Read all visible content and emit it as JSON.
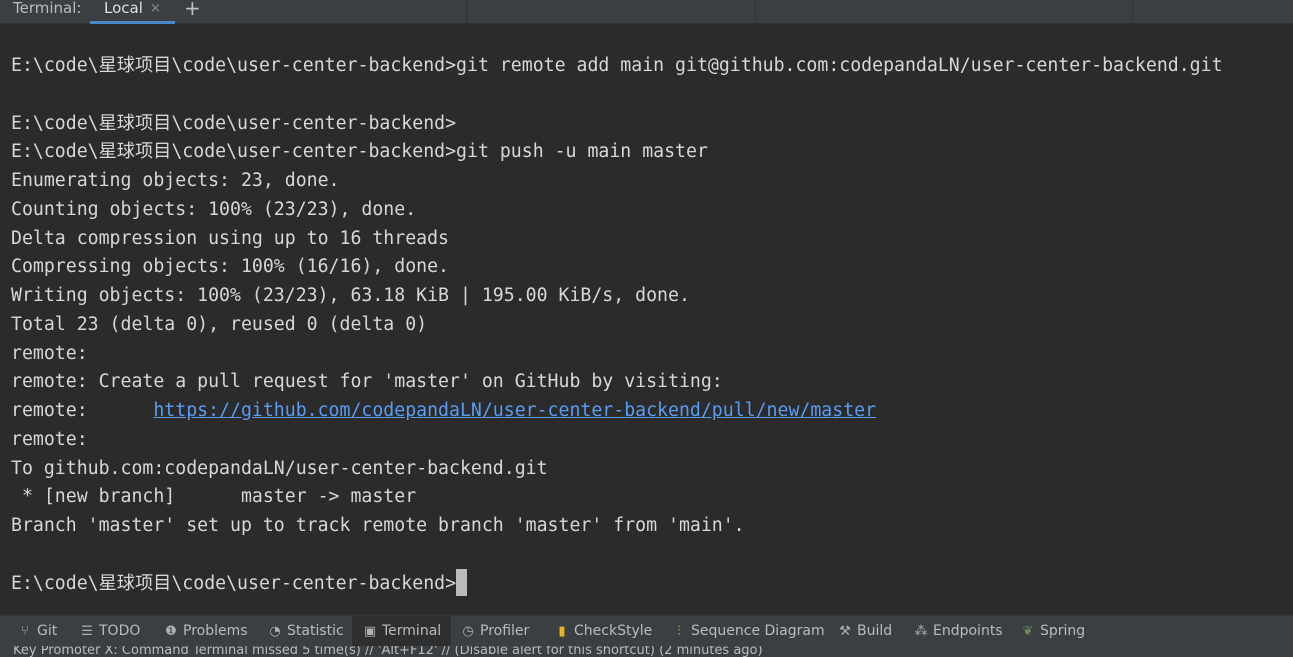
{
  "tabbar": {
    "label": "Terminal:",
    "tabs": [
      {
        "label": "Local",
        "close": "×"
      }
    ],
    "add": "+"
  },
  "terminal": {
    "lines": [
      "E:\\code\\星球项目\\code\\user-center-backend>git remote add main git@github.com:codepandaLN/user-center-backend.git",
      "",
      "E:\\code\\星球项目\\code\\user-center-backend>",
      "E:\\code\\星球项目\\code\\user-center-backend>git push -u main master",
      "Enumerating objects: 23, done.",
      "Counting objects: 100% (23/23), done.",
      "Delta compression using up to 16 threads",
      "Compressing objects: 100% (16/16), done.",
      "Writing objects: 100% (23/23), 63.18 KiB | 195.00 KiB/s, done.",
      "Total 23 (delta 0), reused 0 (delta 0)",
      "remote:",
      "remote: Create a pull request for 'master' on GitHub by visiting:",
      "remote:      ",
      "remote:",
      "To github.com:codepandaLN/user-center-backend.git",
      " * [new branch]      master -> master",
      "Branch 'master' set up to track remote branch 'master' from 'main'.",
      "",
      "E:\\code\\星球项目\\code\\user-center-backend>"
    ],
    "link": "https://github.com/codepandaLN/user-center-backend/pull/new/master"
  },
  "tools": [
    {
      "label": "Git",
      "icon": "git-branch-icon"
    },
    {
      "label": "TODO",
      "icon": "list-icon"
    },
    {
      "label": "Problems",
      "icon": "alert-icon"
    },
    {
      "label": "Statistic",
      "icon": "pie-icon"
    },
    {
      "label": "Terminal",
      "icon": "terminal-icon"
    },
    {
      "label": "Profiler",
      "icon": "gauge-icon"
    },
    {
      "label": "CheckStyle",
      "icon": "checkstyle-icon"
    },
    {
      "label": "Sequence Diagram",
      "icon": "sequence-icon"
    },
    {
      "label": "Build",
      "icon": "hammer-icon"
    },
    {
      "label": "Endpoints",
      "icon": "endpoints-icon"
    },
    {
      "label": "Spring",
      "icon": "spring-leaf-icon"
    }
  ],
  "status": "Key Promoter X: Command Terminal missed 5 time(s) // 'Alt+F12' // (Disable alert for this shortcut) (2 minutes ago)",
  "colors": {
    "link": "#589df6",
    "accent": "#4a88c7",
    "background": "#2b2b2b"
  }
}
